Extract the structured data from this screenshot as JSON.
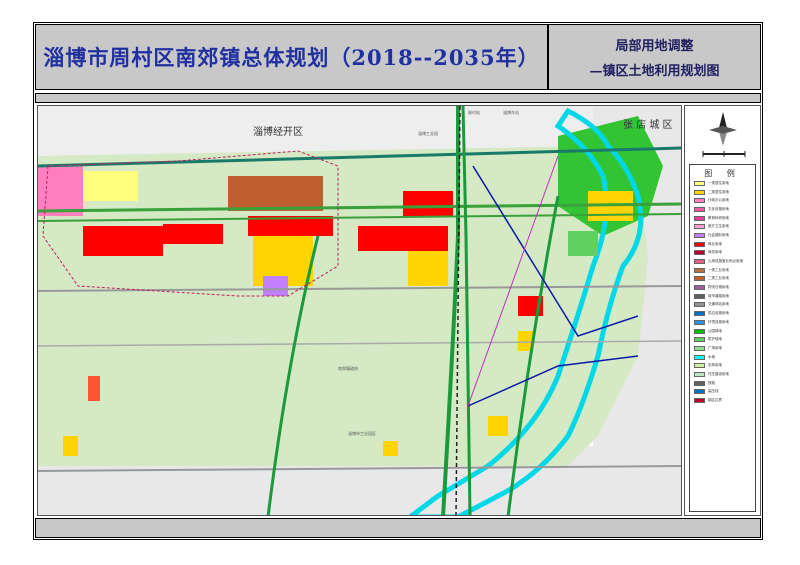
{
  "title": "淄博市周村区南郊镇总体规划（2018--2035年）",
  "subtitle_line1": "局部用地调整",
  "subtitle_line2": "—镇区土地利用规划图",
  "map_labels": {
    "zone_north": "淄博经开区",
    "zone_east": "张 店 城 区",
    "small_1": "周村站",
    "small_2": "淄博东站",
    "small_3": "淄博工业园",
    "small_4": "南郊镇政府",
    "small_5": "淄博市工业园区"
  },
  "legend": {
    "title": "图 例",
    "colors": {
      "r1": "#ffff7f",
      "r2": "#ffd400",
      "a": "#ff7fbf",
      "a2": "#ff55a0",
      "a3": "#e0409a",
      "a5": "#ff9fcf",
      "a6": "#c080ff",
      "b1": "#ff0000",
      "b2": "#c0002a",
      "b4": "#e06080",
      "m1": "#b07040",
      "m2": "#c06030",
      "w1": "#a060a0",
      "s1": "#606060",
      "s4": "#909090",
      "u1": "#0070c0",
      "u2": "#3090e0",
      "g1": "#00c000",
      "g2": "#60d060",
      "g3": "#90e090",
      "e1": "#00ffff",
      "e2": "#d0f0a0",
      "e3": "#c0e8c0"
    },
    "items": [
      {
        "label": "一类居住用地",
        "color_key": "r1"
      },
      {
        "label": "二类居住用地",
        "color_key": "r2"
      },
      {
        "label": "行政办公用地",
        "color_key": "a"
      },
      {
        "label": "文化设施用地",
        "color_key": "a2"
      },
      {
        "label": "教育科研用地",
        "color_key": "a3"
      },
      {
        "label": "医疗卫生用地",
        "color_key": "a5"
      },
      {
        "label": "社会福利用地",
        "color_key": "a6"
      },
      {
        "label": "商业用地",
        "color_key": "b1"
      },
      {
        "label": "商务用地",
        "color_key": "b2"
      },
      {
        "label": "公用设施营业网点用地",
        "color_key": "b4"
      },
      {
        "label": "一类工业用地",
        "color_key": "m1"
      },
      {
        "label": "二类工业用地",
        "color_key": "m2"
      },
      {
        "label": "物流仓储用地",
        "color_key": "w1"
      },
      {
        "label": "城市道路用地",
        "color_key": "s1"
      },
      {
        "label": "交通场站用地",
        "color_key": "s4"
      },
      {
        "label": "供应设施用地",
        "color_key": "u1"
      },
      {
        "label": "环境设施用地",
        "color_key": "u2"
      },
      {
        "label": "公园绿地",
        "color_key": "g1"
      },
      {
        "label": "防护绿地",
        "color_key": "g2"
      },
      {
        "label": "广场用地",
        "color_key": "g3"
      },
      {
        "label": "水域",
        "color_key": "e1"
      },
      {
        "label": "农林用地",
        "color_key": "e2"
      },
      {
        "label": "村庄建设用地",
        "color_key": "e3"
      },
      {
        "label": "铁路",
        "color_key": "s1"
      },
      {
        "label": "高压线",
        "color_key": "u1"
      },
      {
        "label": "镇区边界",
        "color_key": "b2"
      }
    ]
  }
}
